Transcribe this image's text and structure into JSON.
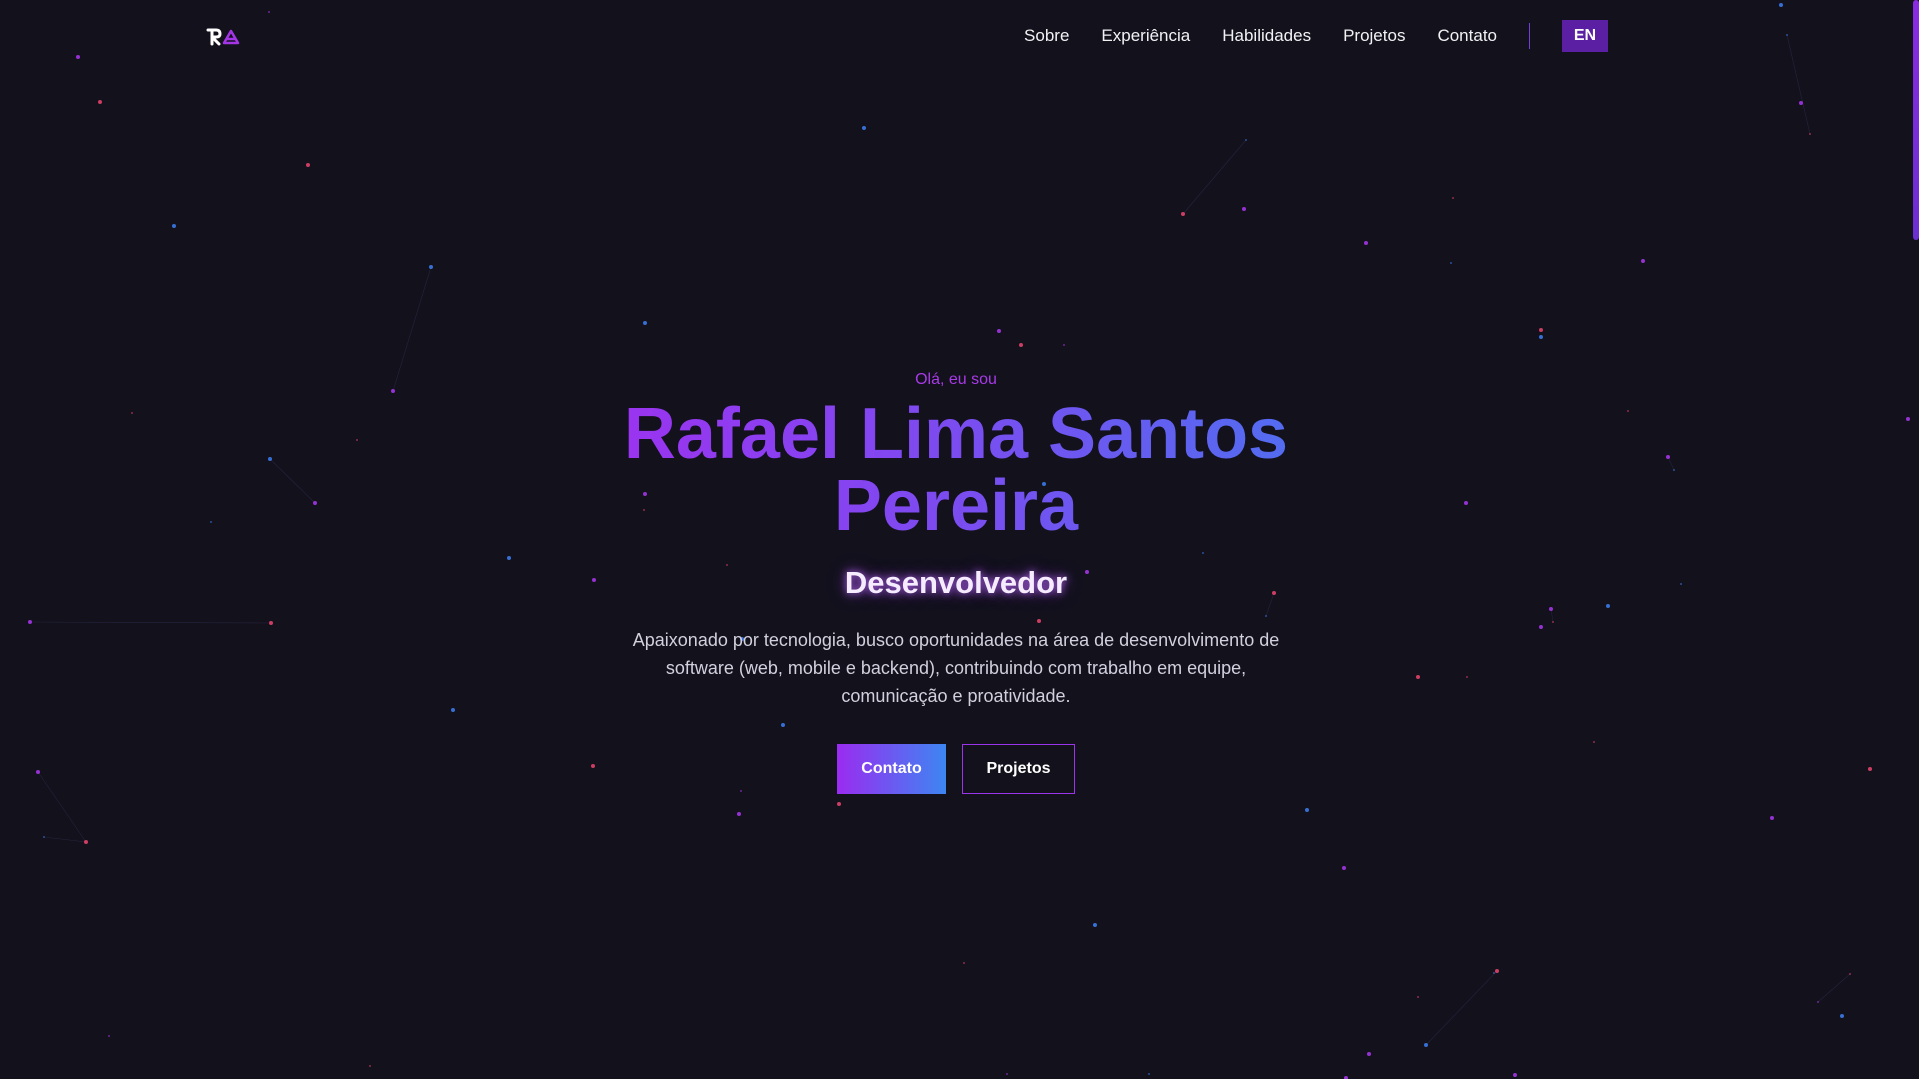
{
  "colors": {
    "background": "#12111c",
    "accent_purple": "#a02ff0",
    "accent_blue": "#4b72f0",
    "particle_purple": "#a435e6",
    "particle_pink": "#e0446a",
    "particle_blue": "#3b7ae8"
  },
  "header": {
    "logo_icon": "ra-monogram-logo",
    "nav": [
      {
        "label": "Sobre"
      },
      {
        "label": "Experiência"
      },
      {
        "label": "Habilidades"
      },
      {
        "label": "Projetos"
      },
      {
        "label": "Contato"
      }
    ],
    "language_button": "EN"
  },
  "hero": {
    "greeting": "Olá, eu sou",
    "name": "Rafael Lima Santos Pereira",
    "role": "Desenvolvedor",
    "description": "Apaixonado por tecnologia, busco oportunidades na área de desenvolvimento de software (web, mobile e backend), contribuindo com trabalho em equipe, comunicação e proatividade.",
    "primary_button": "Contato",
    "secondary_button": "Projetos"
  }
}
